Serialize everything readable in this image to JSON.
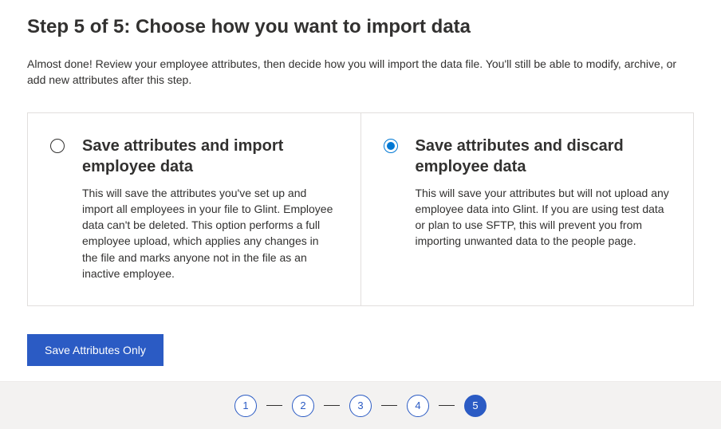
{
  "header": {
    "title": "Step 5 of 5: Choose how you want to import data",
    "description": "Almost done! Review your employee attributes, then decide how you will import the data file. You'll still be able to modify, archive, or add new attributes after this step."
  },
  "options": {
    "save_and_import": {
      "title": "Save attributes and import employee data",
      "description": "This will save the attributes you've set up and import all employees in your file to Glint. Employee data can't be deleted. This option performs a full employee upload, which applies any changes in the file and marks anyone not in the file as an inactive employee.",
      "selected": false
    },
    "save_and_discard": {
      "title": "Save attributes and discard employee data",
      "description": "This will save your attributes but will not upload any employee data into Glint. If you are using test data or plan to use SFTP, this will prevent you from importing unwanted data to the people page.",
      "selected": true
    }
  },
  "actions": {
    "primary_label": "Save Attributes Only"
  },
  "stepper": {
    "steps": [
      "1",
      "2",
      "3",
      "4",
      "5"
    ],
    "current": 5
  }
}
